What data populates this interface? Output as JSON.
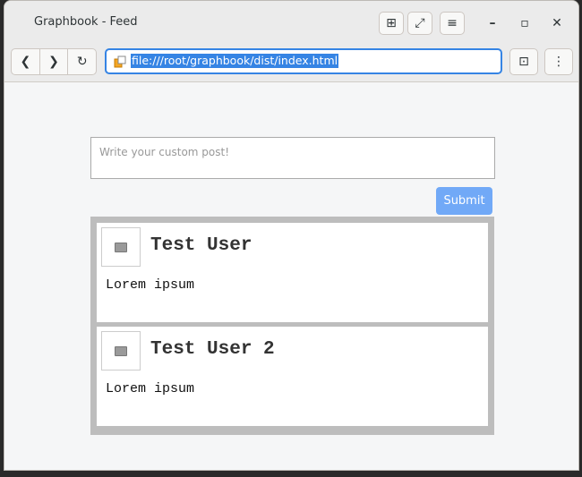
{
  "window": {
    "title": "Graphbook - Feed"
  },
  "toolbar": {
    "url": "file:///root/graphbook/dist/index.html"
  },
  "composer": {
    "placeholder": "Write your custom post!",
    "submit_label": "Submit"
  },
  "posts": [
    {
      "user": "Test User",
      "text": "Lorem ipsum"
    },
    {
      "user": "Test User 2",
      "text": "Lorem ipsum"
    }
  ],
  "colors": {
    "accent": "#3584e4",
    "submit": "#71a9f7",
    "feed_border": "#bdbdbd"
  },
  "icons": [
    "new-tab-icon",
    "fullscreen-icon",
    "menu-icon",
    "minimize-icon",
    "maximize-icon",
    "close-icon",
    "back-icon",
    "forward-icon",
    "reload-icon",
    "site-info-icon",
    "bookmark-icon",
    "more-icon",
    "avatar-image-icon"
  ]
}
